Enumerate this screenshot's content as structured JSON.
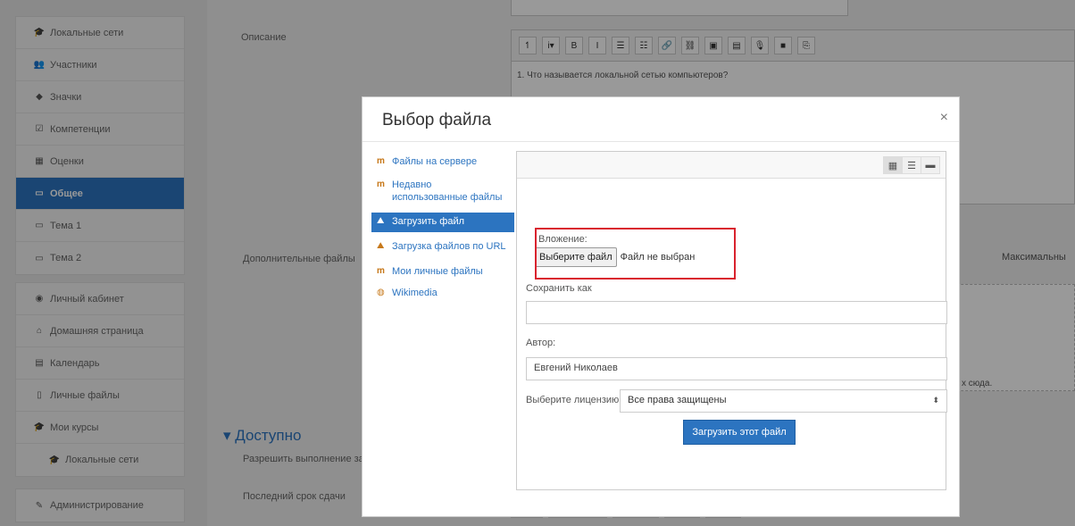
{
  "sidebar": {
    "group1": [
      {
        "icon": "graduation-cap-icon",
        "glyph": "🎓",
        "label": "Локальные сети"
      },
      {
        "icon": "users-icon",
        "glyph": "👥",
        "label": "Участники"
      },
      {
        "icon": "shield-icon",
        "glyph": "◆",
        "label": "Значки"
      },
      {
        "icon": "checkbox-icon",
        "glyph": "☑",
        "label": "Компетенции"
      },
      {
        "icon": "table-icon",
        "glyph": "▦",
        "label": "Оценки"
      },
      {
        "icon": "folder-icon",
        "glyph": "▭",
        "label": "Общее"
      },
      {
        "icon": "folder-icon",
        "glyph": "▭",
        "label": "Тема 1"
      },
      {
        "icon": "folder-icon",
        "glyph": "▭",
        "label": "Тема 2"
      }
    ],
    "group2": [
      {
        "icon": "dashboard-icon",
        "glyph": "◉",
        "label": "Личный кабинет"
      },
      {
        "icon": "home-icon",
        "glyph": "⌂",
        "label": "Домашняя страница"
      },
      {
        "icon": "calendar-icon",
        "glyph": "▤",
        "label": "Календарь"
      },
      {
        "icon": "file-icon",
        "glyph": "▯",
        "label": "Личные файлы"
      },
      {
        "icon": "graduation-cap-icon",
        "glyph": "🎓",
        "label": "Мои курсы"
      },
      {
        "icon": "graduation-cap-icon",
        "glyph": "🎓",
        "label": "Локальные сети"
      }
    ],
    "admin": {
      "icon": "wrench-icon",
      "glyph": "✎",
      "label": "Администрирование"
    }
  },
  "form": {
    "description_label": "Описание",
    "editor_text": "1. Что называется локальной сетью компьютеров?",
    "additional_files_label": "Дополнительные файлы",
    "max_label": "Максимальны",
    "drop_hint": "х сюда.",
    "section_title": "Доступно",
    "allow_submissions_label": "Разрешить выполнение за",
    "due_date_label": "Последний срок сдачи"
  },
  "editor_toolbar": [
    "↿",
    "i▾",
    "B",
    "I",
    "☰",
    "☷",
    "🔗",
    "⛓",
    "▣",
    "▤",
    "🎙",
    "■",
    "⎘"
  ],
  "modal": {
    "title": "Выбор файла",
    "close": "×",
    "repositories": [
      {
        "icon": "server-icon",
        "glyph": "𝐦",
        "label": "Файлы на сервере"
      },
      {
        "icon": "recent-icon",
        "glyph": "𝐦",
        "label": "Недавно использованные файлы"
      },
      {
        "icon": "upload-icon",
        "glyph": "⛰",
        "label": "Загрузить файл"
      },
      {
        "icon": "url-download-icon",
        "glyph": "⛰",
        "label": "Загрузка файлов по URL"
      },
      {
        "icon": "private-files-icon",
        "glyph": "𝐦",
        "label": "Мои личные файлы"
      },
      {
        "icon": "wikimedia-icon",
        "glyph": "◍",
        "label": "Wikimedia"
      }
    ],
    "view_buttons": [
      "▦",
      "☰",
      "▬"
    ],
    "attachment_label": "Вложение:",
    "choose_button": "Выберите файл",
    "no_file": "Файл не выбран",
    "save_as_label": "Сохранить как",
    "save_as_value": "",
    "author_label": "Автор:",
    "author_value": "Евгений Николаев",
    "license_label": "Выберите лицензию",
    "license_value": "Все права защищены",
    "upload_button": "Загрузить этот файл"
  }
}
